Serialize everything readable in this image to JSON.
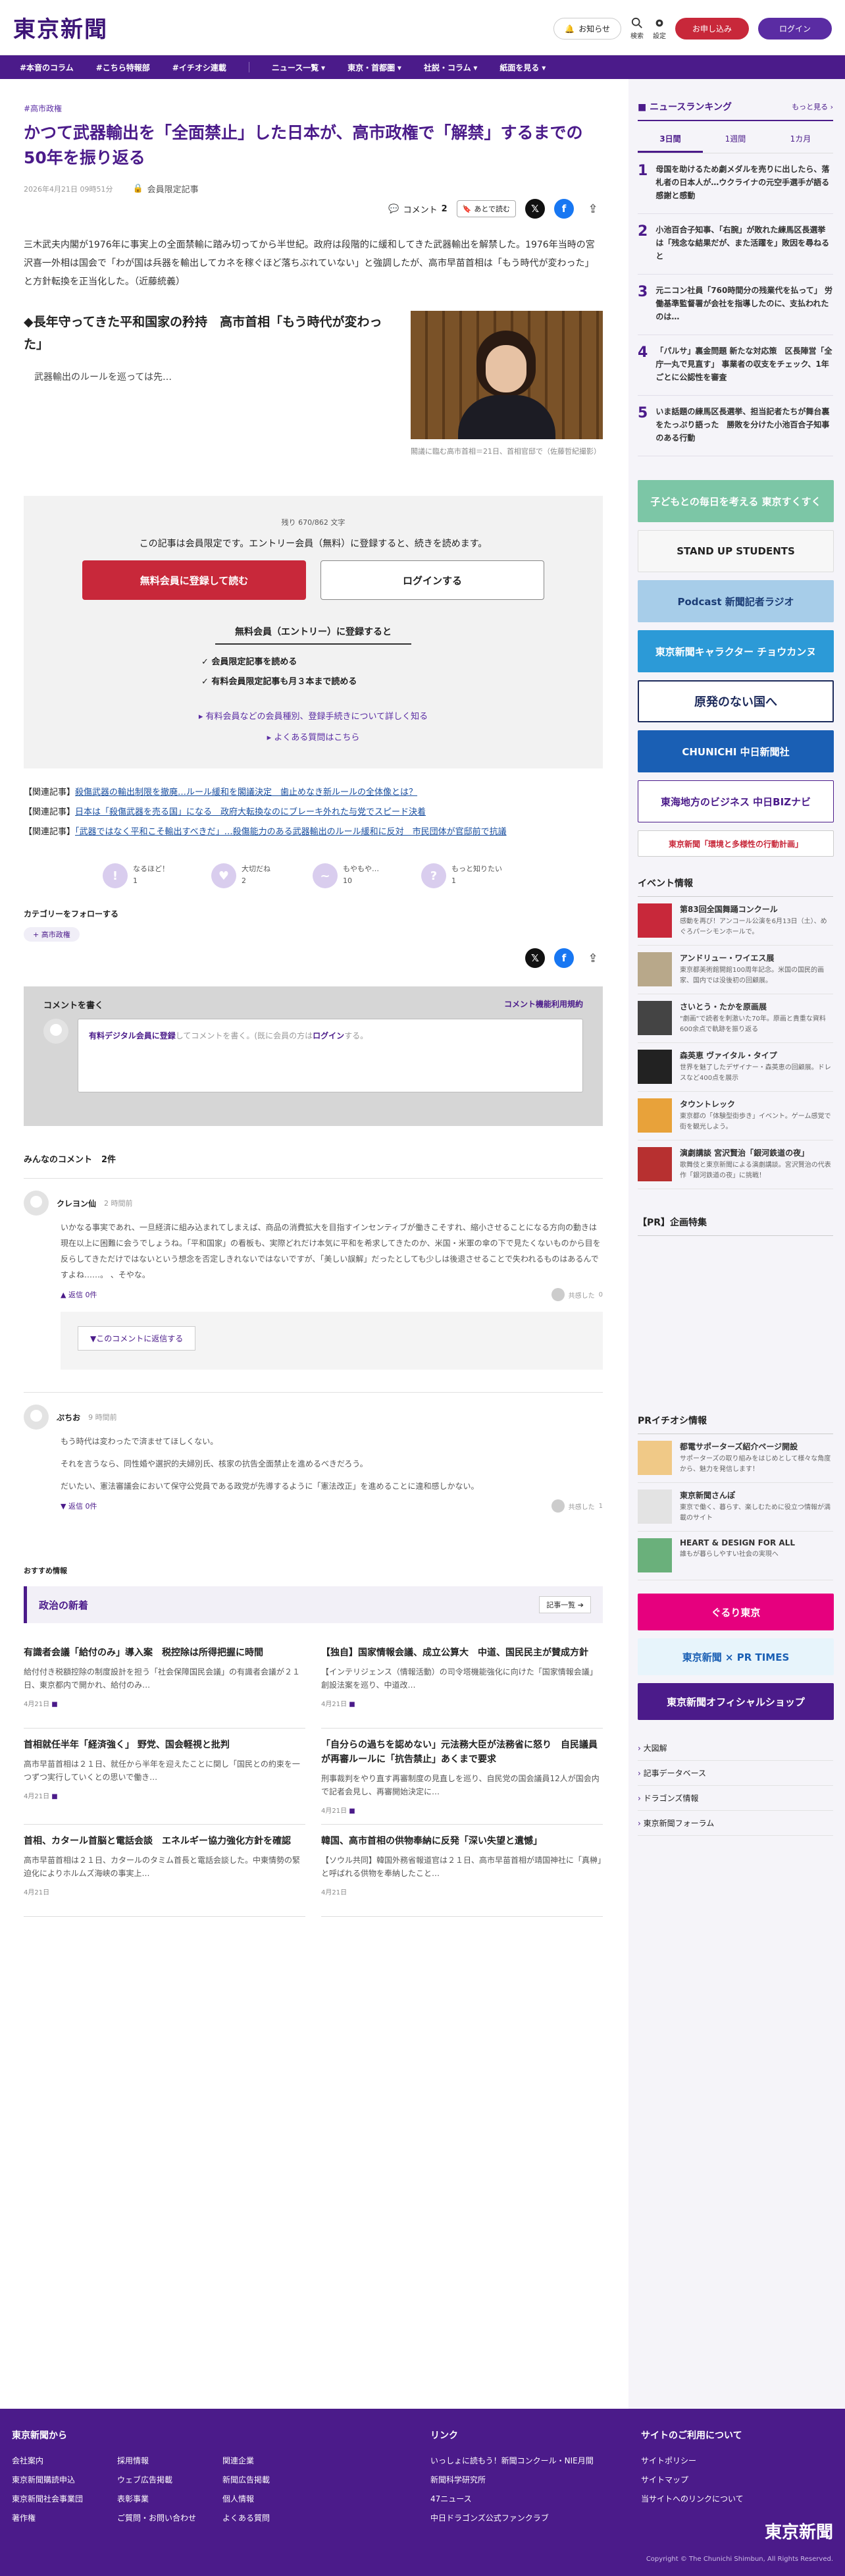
{
  "header": {
    "logo": "東京新聞",
    "notify": "お知らせ",
    "search": "検索",
    "settings": "設定",
    "register": "お申し込み",
    "login": "ログイン"
  },
  "nav": [
    "#本音のコラム",
    "#こちら特報部",
    "#イチオシ連載",
    "ニュース一覧",
    "東京・首都圏",
    "社説・コラム",
    "紙面を見る"
  ],
  "article": {
    "crumb": "#高市政権",
    "title": "かつて武器輸出を「全面禁止」した日本が、高市政権で「解禁」するまでの50年を振り返る",
    "date": "2026年4月21日 09時51分",
    "member": "会員限定記事",
    "comment_label": "コメント",
    "comment_count": "2",
    "read_later": "あとで読む",
    "lead": "三木武夫内閣が1976年に事実上の全面禁輸に踏み切ってから半世紀。政府は段階的に緩和してきた武器輸出を解禁した。1976年当時の宮沢喜一外相は国会で「わが国は兵器を輸出してカネを稼ぐほど落ちぶれていない」と強調したが、高市早苗首相は「もう時代が変わった」と方針転換を正当化した。（近藤統義）",
    "subhead": "◆長年守ってきた平和国家の矜持　高市首相「もう時代が変わった」",
    "sub_text": "武器輸出のルールを巡っては先…",
    "caption": "閣議に臨む高市首相＝21日、首相官邸で（佐藤哲紀撮影）"
  },
  "paywall": {
    "remain": "残り 670/862 文字",
    "msg": "この記事は会員限定です。エントリー会員（無料）に登録すると、続きを読めます。",
    "register": "無料会員に登録して読む",
    "login": "ログインする",
    "head": "無料会員（エントリー）に登録すると",
    "benefits": [
      "会員限定記事を読める",
      "有料会員限定記事も月３本まで読める"
    ],
    "links": [
      "有料会員などの会員種別、登録手続きについて詳しく知る",
      "よくある質問はこちら"
    ]
  },
  "related": [
    {
      "prefix": "【関連記事】",
      "text": "殺傷武器の輸出制限を撤廃…ルール緩和を閣議決定　歯止めなき新ルールの全体像とは？"
    },
    {
      "prefix": "【関連記事】",
      "text": "日本は「殺傷武器を売る国」になる　政府大転換なのにブレーキ外れた与党でスピード決着"
    },
    {
      "prefix": "【関連記事】",
      "text": "「武器ではなく平和こそ輸出すべきだ」…殺傷能力のある武器輸出のルール緩和に反対　市民団体が官邸前で抗議"
    }
  ],
  "reactions": [
    {
      "label": "なるほど！",
      "n": "1"
    },
    {
      "label": "大切だね",
      "n": "2"
    },
    {
      "label": "もやもや…",
      "n": "10"
    },
    {
      "label": "もっと知りたい",
      "n": "1"
    }
  ],
  "follow": {
    "head": "カテゴリーをフォローする",
    "tag": "+ 高市政権"
  },
  "comment_box": {
    "title": "コメントを書く",
    "rules": "コメント機能利用規約",
    "placeholder_a": "有料デジタル会員に登録",
    "placeholder_b": "してコメントを書く。(既に会員の方は",
    "placeholder_c": "ログイン",
    "placeholder_d": "する。"
  },
  "comments_head": {
    "title": "みんなのコメント",
    "count": "2件"
  },
  "comments": [
    {
      "user": "クレヨン仙",
      "time": "2 時間前",
      "body": "いかなる事実であれ、一旦経済に組み込まれてしまえば、商品の消費拡大を目指すインセンティブが働きこそすれ、縮小させることになる方向の動きは現在以上に困難に会うでしょうね。「平和国家」の看板も、実際どれだけ本気に平和を希求してきたのか、米国・米軍の傘の下で見たくないものから目を反らしてきただけではないという想念を否定しきれないではないですが、「美しい誤解」だったとしても少しは後退させることで失われるものはあるんですよね……。 、そやな。",
      "reply": "返信",
      "reply_n": "0件",
      "like": "共感した",
      "like_n": "0",
      "reply_btn": "▼このコメントに返信する"
    },
    {
      "user": "ぷちお",
      "time": "9 時間前",
      "body1": "もう時代は変わったで済ませてほしくない。",
      "body2": "それを言うなら、同性婚や選択的夫婦別氏、核家の抗告全面禁止を進めるべきだろう。",
      "body3": "だいたい、憲法審議会において保守公党員である政党が先導するように「憲法改正」を進めることに違和感しかない。",
      "reply": "返信",
      "reply_n": "0件",
      "like": "共感した",
      "like_n": "1"
    }
  ],
  "recommend": "おすすめ情報",
  "news": {
    "head": "政治の新着",
    "more": "記事一覧",
    "items": [
      {
        "title": "有識者会議「給付のみ」導入案　税控除は所得把握に時間",
        "body": "給付付き税額控除の制度設計を担う「社会保障国民会議」の有識者会議が２１日、東京都内で開かれ、給付のみ…",
        "date": "4月21日"
      },
      {
        "title": "【独自】国家情報会議、成立公算大　中道、国民民主が賛成方針",
        "body": "【インテリジェンス（情報活動）の司令塔機能強化に向けた「国家情報会議」創設法案を巡り、中道改…",
        "date": "4月21日"
      },
      {
        "title": "首相就任半年「経済強く」 野党、国会軽視と批判",
        "body": "高市早苗首相は２１日、就任から半年を迎えたことに関し「国民との約束を一つずつ実行していくとの思いで働き…",
        "date": "4月21日"
      },
      {
        "title": "「自分らの過ちを認めない」元法務大臣が法務省に怒り　自民議員が再審ルールに「抗告禁止」あくまで要求",
        "body": "刑事裁判をやり直す再審制度の見直しを巡り、自民党の国会議員12人が国会内で記者会見し、再審開始決定に…",
        "date": "4月21日"
      },
      {
        "title": "首相、カタール首脳と電話会談　エネルギー協力強化方針を確認",
        "body": "高市早苗首相は２１日、カタールのタミム首長と電話会談した。中東情勢の緊迫化によりホルムズ海峡の事実上…",
        "date": "4月21日"
      },
      {
        "title": "韓国、高市首相の供物奉納に反発「深い失望と遺憾」",
        "body": "【ソウル共同】韓国外務省報道官は２１日、高市早苗首相が靖国神社に「真榊」と呼ばれる供物を奉納したこと…",
        "date": "4月21日"
      }
    ]
  },
  "sidebar": {
    "rank_title": "ニュースランキング",
    "rank_more": "もっと見る",
    "tabs": [
      "3日間",
      "1週間",
      "1カ月"
    ],
    "ranks": [
      {
        "n": "1",
        "t": "母国を助けるため劇メダルを売りに出したら、落札者の日本人が…ウクライナの元空手選手が語る感謝と感動"
      },
      {
        "n": "2",
        "t": "小池百合子知事、「右腕」が敗れた練馬区長選挙は「残念な結果だが、また活躍を」敗因を尋ねると"
      },
      {
        "n": "3",
        "t": "元ニコン社員「760時間分の残業代を払って」 労働基準監督署が会社を指導したのに、支払われたのは…"
      },
      {
        "n": "4",
        "t": "「パルサ」裏金問題 新たな対応策　区長陣営「全庁一丸で見直す」 事業者の収支をチェック、1年ごとに公認性を審査"
      },
      {
        "n": "5",
        "t": "いま話題の練馬区長選挙、担当記者たちが舞台裏をたっぷり語った　勝敗を分けた小池百合子知事のある行動"
      }
    ],
    "banners": [
      "子どもとの毎日を考える 東京すくすく",
      "STAND UP STUDENTS",
      "Podcast 新聞記者ラジオ",
      "東京新聞キャラクター チョウカンヌ",
      "原発のない国へ",
      "CHUNICHI 中日新聞社",
      "東海地方のビジネス 中日BIZナビ",
      "東京新聞「環境と多様性の行動計画」"
    ],
    "events_title": "イベント情報",
    "events": [
      {
        "t": "第83回全国舞踊コンクール",
        "d": "感動を再び！アンコール公演を6月13日（土）、めぐろパーシモンホールで。"
      },
      {
        "t": "アンドリュー・ワイエス展",
        "d": "東京都美術館開館100周年記念。米国の国民的画家、国内では没後初の回顧展。"
      },
      {
        "t": "さいとう・たかを原画展",
        "d": "\"劇画\"で読者を刺激いた70年。原画と貴重な資料600余点で軌跡を振り返る"
      },
      {
        "t": "森英恵 ヴァイタル・タイプ",
        "d": "世界を魅了したデザイナー・森英恵の回顧展。ドレスなど400点を展示"
      },
      {
        "t": "タウントレック",
        "d": "東京都の「体験型街歩き」イベント。ゲーム感覚で街を観光しよう。"
      },
      {
        "t": "演劇講談 宮沢賢治「銀河鉄道の夜」",
        "d": "歌舞伎と東京新聞による演劇講談。宮沢賢治の代表作「銀河鉄道の夜」に挑戦！"
      }
    ],
    "pr_title": "【PR】企画特集",
    "pr2_title": "PRイチオシ情報",
    "pr_items": [
      {
        "t": "都電サポーターズ紹介ページ開設",
        "d": "サポーターズの取り組みをはじめとして様々な角度から、魅力を発信します！"
      },
      {
        "t": "東京新聞さんぽ",
        "d": "東京で働く、暮らす、楽しむために役立つ情報が満載のサイト"
      },
      {
        "t": "HEART & DESIGN FOR ALL",
        "d": "誰もが暮らしやすい社会の実現へ"
      }
    ],
    "banners2": [
      "ぐるり東京",
      "東京新聞 × PR TIMES",
      "東京新聞オフィシャルショップ"
    ],
    "links": [
      "大図解",
      "記事データベース",
      "ドラゴンズ情報",
      "東京新聞フォーラム"
    ]
  },
  "footer": {
    "col1_title": "東京新聞から",
    "col1": [
      "会社案内",
      "採用情報",
      "関連企業",
      "東京新聞購読申込",
      "ウェブ広告掲載",
      "新聞広告掲載",
      "東京新聞社会事業団",
      "表彰事業",
      "個人情報",
      "著作権",
      "ご質問・お問い合わせ",
      "よくある質問"
    ],
    "col2_title": "リンク",
    "col2": [
      "いっしょに読もう！新聞コンクール・NIE月間",
      "新聞科学研究所",
      "47ニュース",
      "中日ドラゴンズ公式ファンクラブ"
    ],
    "col3_title": "サイトのご利用について",
    "col3": [
      "サイトポリシー",
      "サイトマップ",
      "当サイトへのリンクについて"
    ],
    "logo": "東京新聞",
    "copy": "Copyright © The Chunichi Shimbun, All Rights Reserved."
  },
  "colors": {
    "brand": "#4b1b8a",
    "accent_red": "#c8283a"
  }
}
